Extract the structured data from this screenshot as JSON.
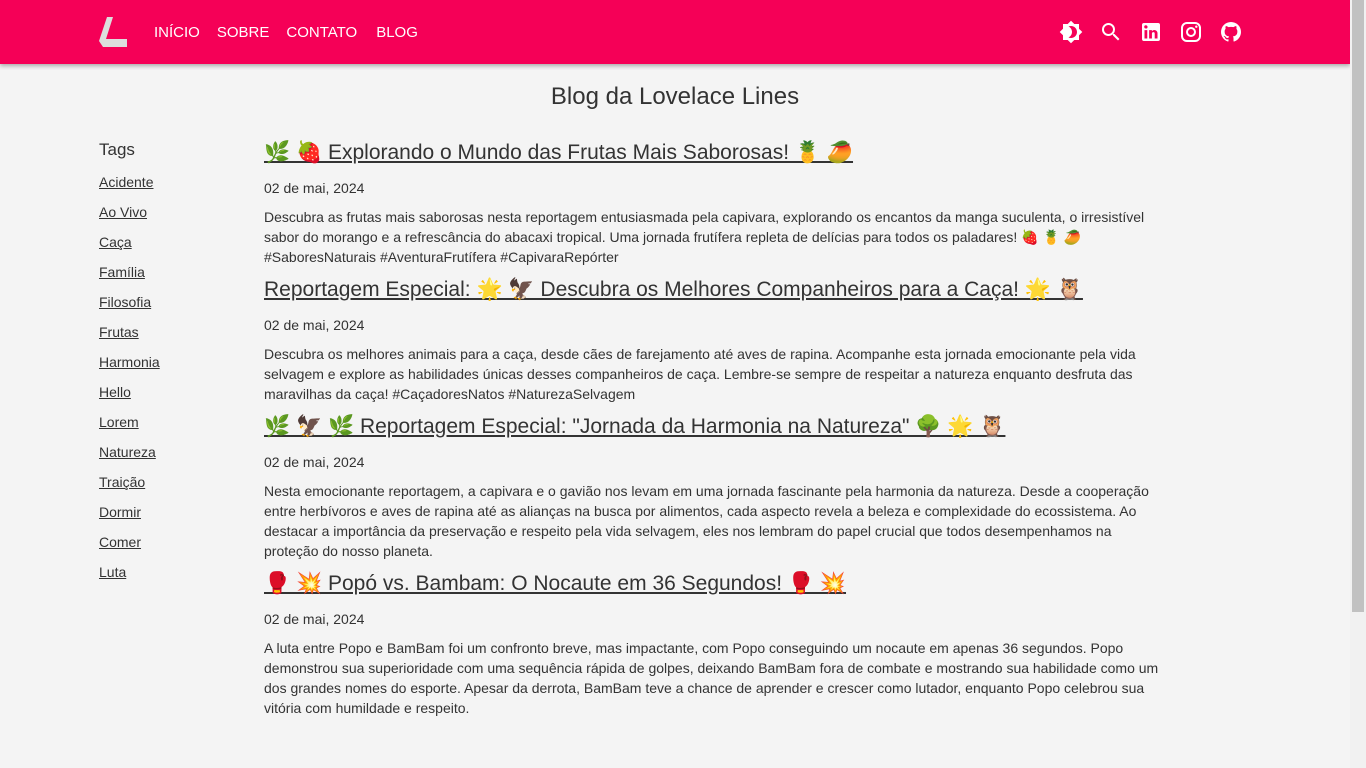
{
  "header": {
    "nav": [
      "INÍCIO",
      "SOBRE",
      "CONTATO",
      "BLOG"
    ],
    "brand_color": "#f50057"
  },
  "page_title": "Blog da Lovelace Lines",
  "tags": {
    "heading": "Tags",
    "items": [
      "Acidente",
      "Ao Vivo",
      "Caça",
      "Família",
      "Filosofia",
      "Frutas",
      "Harmonia",
      "Hello",
      "Lorem",
      "Natureza",
      "Traição",
      "Dormir",
      "Comer",
      "Luta"
    ]
  },
  "posts": [
    {
      "title": "🌿 🍓  Explorando o Mundo das Frutas Mais Saborosas! 🍍 🥭 ",
      "date": "02 de mai, 2024",
      "body": "Descubra as frutas mais saborosas nesta reportagem entusiasmada pela capivara, explorando os encantos da manga suculenta, o irresistível sabor do morango e a refrescância do abacaxi tropical. Uma jornada frutífera repleta de delícias para todos os paladares! 🍓 🍍 🥭 #SaboresNaturais #AventuraFrutífera #CapivaraRepórter"
    },
    {
      "title": "Reportagem Especial: 🌟 🦅  Descubra os Melhores Companheiros para a Caça! 🌟 🦉 ",
      "date": "02 de mai, 2024",
      "body": "Descubra os melhores animais para a caça, desde cães de farejamento até aves de rapina. Acompanhe esta jornada emocionante pela vida selvagem e explore as habilidades únicas desses companheiros de caça. Lembre-se sempre de respeitar a natureza enquanto desfruta das maravilhas da caça! #CaçadoresNatos #NaturezaSelvagem"
    },
    {
      "title": "🌿 🦅 🌿  Reportagem Especial: \"Jornada da Harmonia na Natureza\" 🌳 🌟 🦉 ",
      "date": "02 de mai, 2024",
      "body": "Nesta emocionante reportagem, a capivara e o gavião nos levam em uma jornada fascinante pela harmonia da natureza. Desde a cooperação entre herbívoros e aves de rapina até as alianças na busca por alimentos, cada aspecto revela a beleza e complexidade do ecossistema. Ao destacar a importância da preservação e respeito pela vida selvagem, eles nos lembram do papel crucial que todos desempenhamos na proteção do nosso planeta."
    },
    {
      "title": "🥊 💥  Popó vs. Bambam: O Nocaute em 36 Segundos! 🥊 💥 ",
      "date": "02 de mai, 2024",
      "body": "A luta entre Popo e BamBam foi um confronto breve, mas impactante, com Popo conseguindo um nocaute em apenas 36 segundos. Popo demonstrou sua superioridade com uma sequência rápida de golpes, deixando BamBam fora de combate e mostrando sua habilidade como um dos grandes nomes do esporte. Apesar da derrota, BamBam teve a chance de aprender e crescer como lutador, enquanto Popo celebrou sua vitória com humildade e respeito."
    }
  ]
}
